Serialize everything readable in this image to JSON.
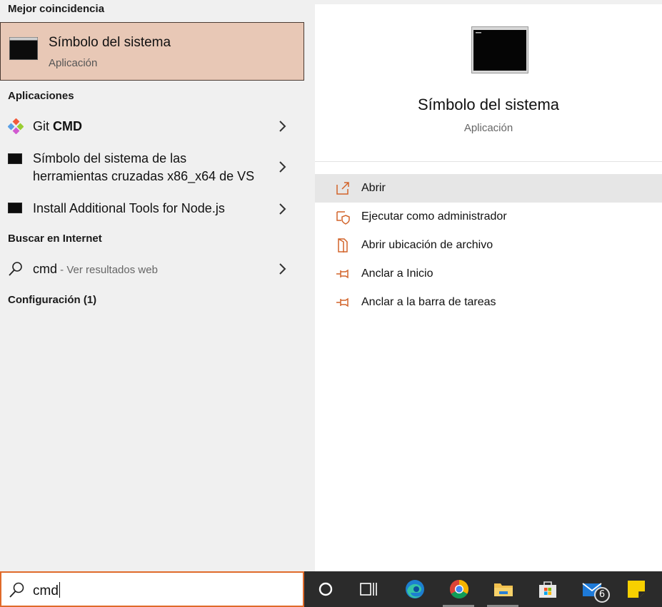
{
  "sections": {
    "best_match": "Mejor coincidencia",
    "apps": "Aplicaciones",
    "web": "Buscar en Internet",
    "settings": "Configuración (1)"
  },
  "best": {
    "title": "Símbolo del sistema",
    "subtitle": "Aplicación"
  },
  "apps": [
    {
      "pre": "Git ",
      "bold": "CMD"
    },
    {
      "line1": "Símbolo del sistema de las",
      "line2": "herramientas cruzadas x86_x64 de VS"
    },
    {
      "label": "Install Additional Tools for Node.js"
    }
  ],
  "web": {
    "query": "cmd",
    "suffix": " - Ver resultados web"
  },
  "detail": {
    "title": "Símbolo del sistema",
    "subtitle": "Aplicación"
  },
  "actions": [
    {
      "label": "Abrir",
      "icon": "open-icon"
    },
    {
      "label": "Ejecutar como administrador",
      "icon": "shield-icon"
    },
    {
      "label": "Abrir ubicación de archivo",
      "icon": "file-location-icon"
    },
    {
      "label": "Anclar a Inicio",
      "icon": "pin-icon"
    },
    {
      "label": "Anclar a la barra de tareas",
      "icon": "pin-icon"
    }
  ],
  "search": {
    "value": "cmd"
  },
  "taskbar": {
    "mail_badge": "6",
    "items": [
      "cortana-icon",
      "task-view-icon",
      "edge-icon",
      "chrome-icon",
      "file-explorer-icon",
      "store-icon",
      "mail-icon",
      "sticky-notes-icon"
    ]
  },
  "colors": {
    "accent": "#e06a2a",
    "selection": "#e8c8b6",
    "taskbar": "#2b2b2b"
  }
}
